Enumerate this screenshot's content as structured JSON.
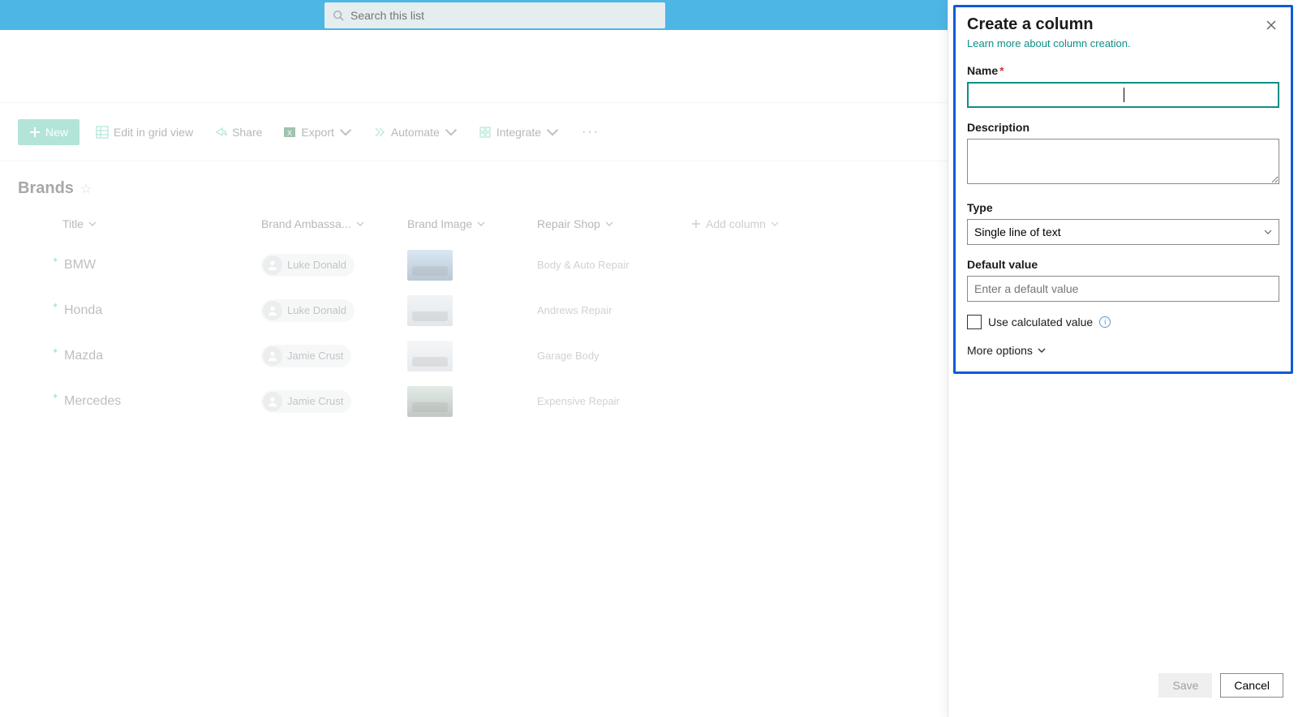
{
  "topbar": {
    "search_placeholder": "Search this list"
  },
  "toolbar": {
    "new_label": "New",
    "edit_label": "Edit in grid view",
    "share_label": "Share",
    "export_label": "Export",
    "automate_label": "Automate",
    "integrate_label": "Integrate"
  },
  "list": {
    "title": "Brands",
    "columns": {
      "title": "Title",
      "ambassador": "Brand Ambassa...",
      "image": "Brand Image",
      "repair": "Repair Shop",
      "add": "Add column"
    },
    "rows": [
      {
        "title": "BMW",
        "ambassador": "Luke Donald",
        "repair": "Body & Auto Repair",
        "thumb": "car1"
      },
      {
        "title": "Honda",
        "ambassador": "Luke Donald",
        "repair": "Andrews Repair",
        "thumb": "car2"
      },
      {
        "title": "Mazda",
        "ambassador": "Jamie Crust",
        "repair": "Garage Body",
        "thumb": "car3"
      },
      {
        "title": "Mercedes",
        "ambassador": "Jamie Crust",
        "repair": "Expensive Repair",
        "thumb": "car4"
      }
    ]
  },
  "panel": {
    "title": "Create a column",
    "learn": "Learn more about column creation.",
    "name_label": "Name",
    "name_value": "",
    "desc_label": "Description",
    "desc_value": "",
    "type_label": "Type",
    "type_value": "Single line of text",
    "default_label": "Default value",
    "default_placeholder": "Enter a default value",
    "default_value": "",
    "calc_label": "Use calculated value",
    "more_label": "More options",
    "save_label": "Save",
    "cancel_label": "Cancel"
  }
}
